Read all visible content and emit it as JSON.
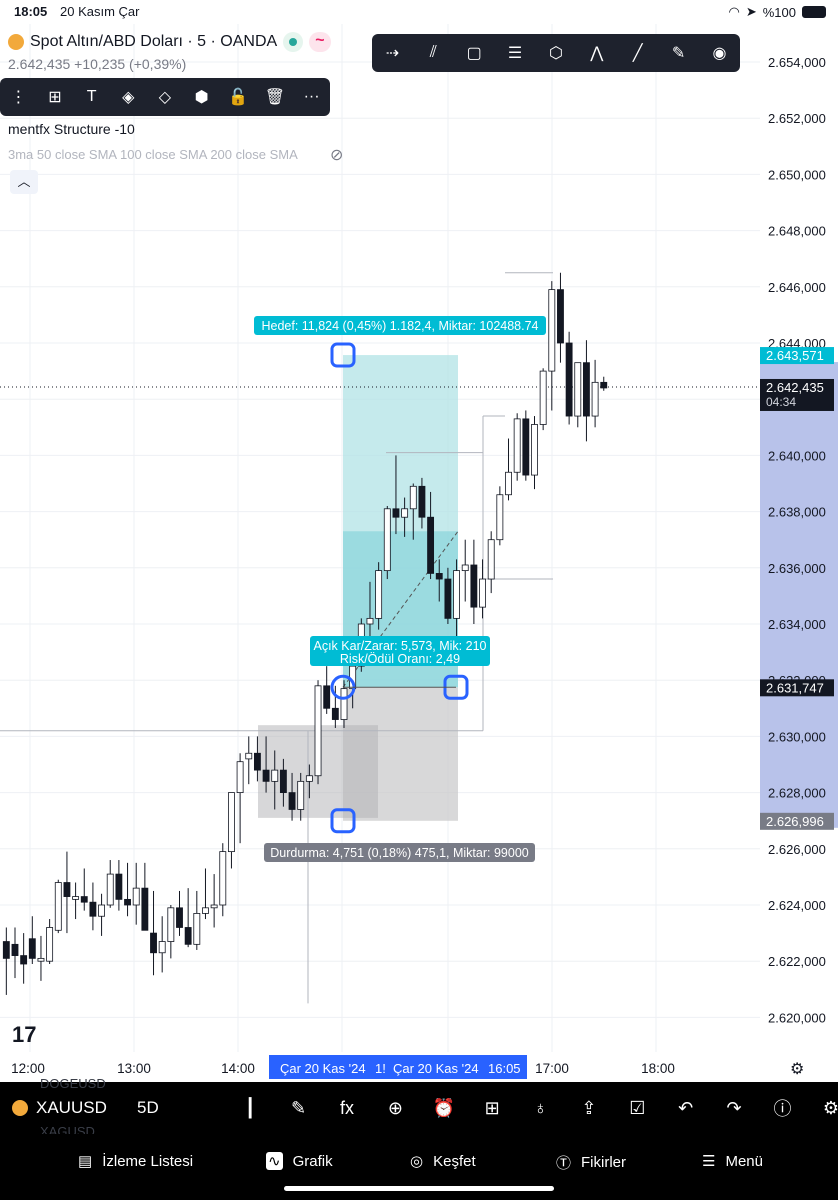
{
  "status_bar": {
    "time": "18:05",
    "date": "20 Kasım Çar",
    "battery": "%100"
  },
  "header": {
    "symbol_title": "Spot Altın/ABD Doları · 5 · OANDA",
    "pill_icon": "~",
    "price_line": "2.642,435 +10,235 (+0,39%)"
  },
  "draw_toolbar": {
    "icons": [
      "horizontal-ray-icon",
      "parallel-channel-icon",
      "rectangle-icon",
      "text-lines-icon",
      "pattern-icon",
      "zigzag-icon",
      "trendline-icon",
      "brush-icon",
      "eye-icon"
    ]
  },
  "edit_toolbar": {
    "icons": [
      "drag-handle-icon",
      "add-icon",
      "text-icon",
      "fill-icon",
      "paint-bucket-icon",
      "hexagon-icon",
      "lock-icon",
      "trash-icon",
      "more-icon"
    ],
    "more_label": "···"
  },
  "indicators": {
    "structure": "mentfx Structure -10",
    "sma": "3ma 50 close SMA 100 close SMA 200 close SMA"
  },
  "price_axis": {
    "ticks": [
      "2.654,000",
      "2.652,000",
      "2.650,000",
      "2.648,000",
      "2.646,000",
      "2.644,000",
      "2.642,000",
      "2.640,000",
      "2.638,000",
      "2.636,000",
      "2.634,000",
      "2.632,000",
      "2.630,000",
      "2.628,000",
      "2.626,000",
      "2.624,000",
      "2.622,000",
      "2.620,000"
    ],
    "target_label": "2.643,571",
    "current_price": "2.642,435",
    "countdown": "04:34",
    "entry_label": "2.631,747",
    "stop_label": "2.626,996"
  },
  "time_axis": {
    "ticks": [
      "12:00",
      "13:00",
      "14:00",
      "17:00",
      "18:00"
    ],
    "range_start": "Çar 20 Kas '24",
    "range_mid": "1!",
    "range_end_date": "Çar 20 Kas '24",
    "range_end_time": "16:05"
  },
  "position_tool": {
    "target_text": "Hedef: 11,824 (0,45%) 1.182,4, Miktar: 102488.74",
    "pnl_text": "Açık Kar/Zarar: 5,573, Mik: 210",
    "rr_text": "Risk/Ödül Oranı: 2,49",
    "stop_text": "Durdurma: 4,751 (0,18%) 475,1, Miktar: 99000"
  },
  "colors": {
    "up": "#ffffff",
    "down": "#131722",
    "target_zone": "#b2e3e6",
    "stop_zone": "#c7c7c9",
    "label_teal": "#00bcd4",
    "axis_highlight": "#b8c2ea",
    "handle": "#2962ff"
  },
  "bottom_toolbar": {
    "symbol": "XAUUSD",
    "timeframe": "5D",
    "ghost_top": "DOGEUSD",
    "ghost_bottom": "XAGUSD",
    "icons": [
      "candles-icon",
      "pen-icon",
      "fx-icon",
      "plus-circle-icon",
      "alarm-icon",
      "layout-icon",
      "bulb-icon",
      "share-icon",
      "order-icon",
      "undo-icon",
      "redo-icon",
      "info-icon",
      "settings-icon"
    ]
  },
  "nav": {
    "watchlist": "İzleme Listesi",
    "chart": "Grafik",
    "explore": "Keşfet",
    "ideas": "Fikirler",
    "menu": "Menü"
  },
  "watermark": "17"
}
